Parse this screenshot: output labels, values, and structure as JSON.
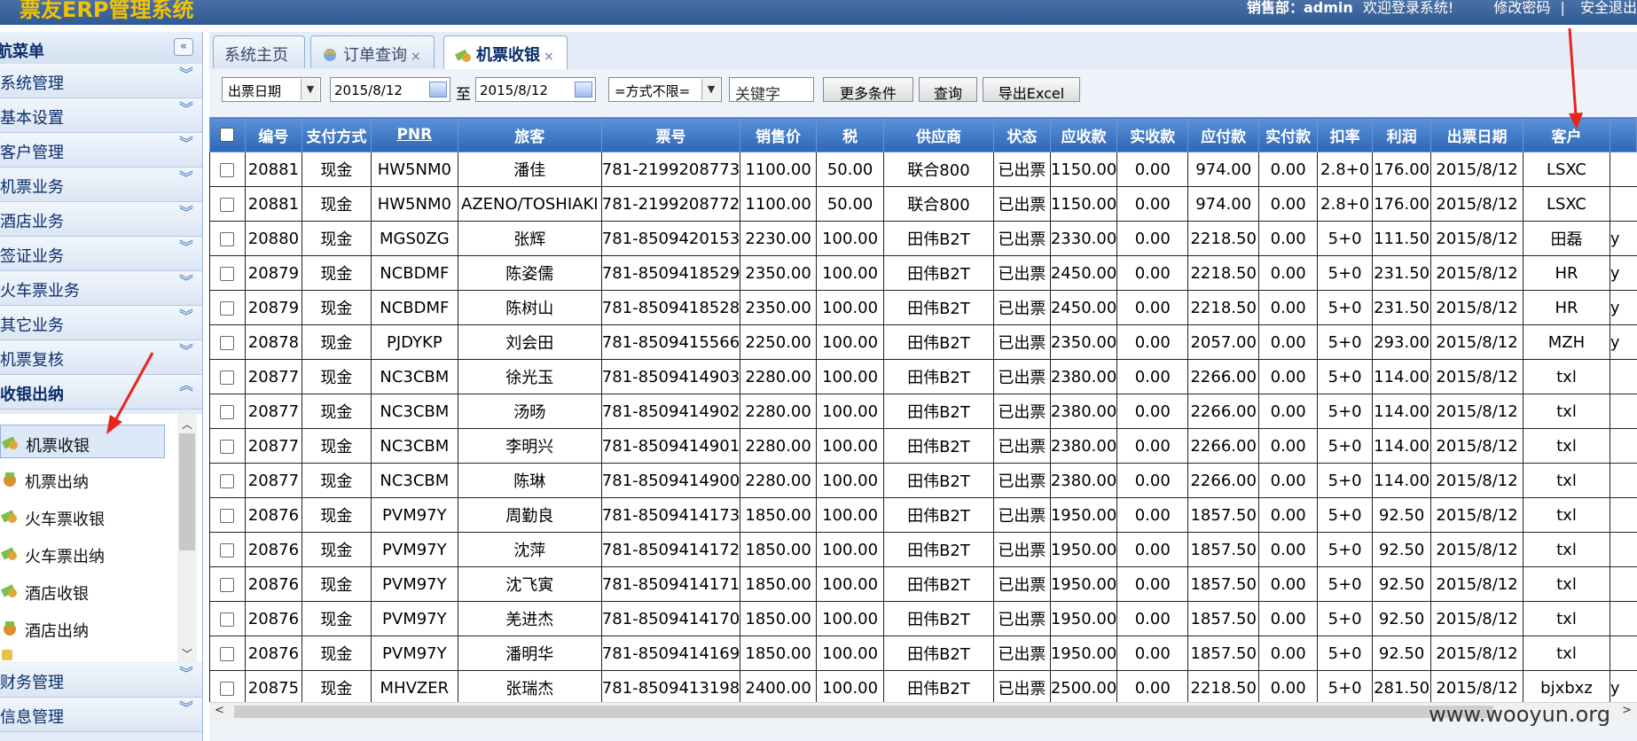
{
  "header": {
    "app_title": "票友ERP管理系统",
    "user_label": "销售部：admin",
    "welcome": "欢迎登录系统!",
    "change_password": "修改密码",
    "separator": "|",
    "logout": "安全退出"
  },
  "sidebar": {
    "title": "航菜单",
    "collapse_icon": "«",
    "groups": [
      {
        "label": "系统管理"
      },
      {
        "label": "基本设置"
      },
      {
        "label": "客户管理"
      },
      {
        "label": "机票业务"
      },
      {
        "label": "酒店业务"
      },
      {
        "label": "签证业务"
      },
      {
        "label": "火车票业务"
      },
      {
        "label": "其它业务"
      },
      {
        "label": "机票复核"
      },
      {
        "label": "收银出纳"
      }
    ],
    "sub_items": [
      {
        "label": "机票收银"
      },
      {
        "label": "机票出纳"
      },
      {
        "label": "火车票收银"
      },
      {
        "label": "火车票出纳"
      },
      {
        "label": "酒店收银"
      },
      {
        "label": "酒店出纳"
      }
    ],
    "bottom_groups": [
      {
        "label": "财务管理"
      },
      {
        "label": "信息管理"
      }
    ]
  },
  "tabs": [
    {
      "label": "系统主页",
      "closable": false
    },
    {
      "label": "订单查询",
      "closable": true
    },
    {
      "label": "机票收银",
      "closable": true,
      "active": true
    }
  ],
  "close_glyph": "×",
  "toolbar": {
    "date_type": "出票日期",
    "date_from": "2015/8/12",
    "to_label": "至",
    "date_to": "2015/8/12",
    "method": "=方式不限=",
    "keyword_placeholder": "关键字",
    "more_conditions": "更多条件",
    "query": "查询",
    "export_excel": "导出Excel"
  },
  "grid": {
    "columns": [
      "编号",
      "支付方式",
      "PNR",
      "旅客",
      "票号",
      "销售价",
      "税",
      "供应商",
      "状态",
      "应收款",
      "实收款",
      "应付款",
      "实付款",
      "扣率",
      "利润",
      "出票日期",
      "客户",
      ""
    ],
    "rows": [
      [
        "20881",
        "现金",
        "HW5NM0",
        "潘佳",
        "781-2199208773",
        "1100.00",
        "50.00",
        "联合800",
        "已出票",
        "1150.00",
        "0.00",
        "974.00",
        "0.00",
        "2.8+0",
        "176.00",
        "2015/8/12",
        "LSXC",
        ""
      ],
      [
        "20881",
        "现金",
        "HW5NM0",
        "AZENO/TOSHIAKI",
        "781-2199208772",
        "1100.00",
        "50.00",
        "联合800",
        "已出票",
        "1150.00",
        "0.00",
        "974.00",
        "0.00",
        "2.8+0",
        "176.00",
        "2015/8/12",
        "LSXC",
        ""
      ],
      [
        "20880",
        "现金",
        "MGS0ZG",
        "张辉",
        "781-8509420153",
        "2230.00",
        "100.00",
        "田伟B2T",
        "已出票",
        "2330.00",
        "0.00",
        "2218.50",
        "0.00",
        "5+0",
        "111.50",
        "2015/8/12",
        "田磊",
        "y"
      ],
      [
        "20879",
        "现金",
        "NCBDMF",
        "陈姿儒",
        "781-8509418529",
        "2350.00",
        "100.00",
        "田伟B2T",
        "已出票",
        "2450.00",
        "0.00",
        "2218.50",
        "0.00",
        "5+0",
        "231.50",
        "2015/8/12",
        "HR",
        "y"
      ],
      [
        "20879",
        "现金",
        "NCBDMF",
        "陈树山",
        "781-8509418528",
        "2350.00",
        "100.00",
        "田伟B2T",
        "已出票",
        "2450.00",
        "0.00",
        "2218.50",
        "0.00",
        "5+0",
        "231.50",
        "2015/8/12",
        "HR",
        "y"
      ],
      [
        "20878",
        "现金",
        "PJDYKP",
        "刘会田",
        "781-8509415566",
        "2250.00",
        "100.00",
        "田伟B2T",
        "已出票",
        "2350.00",
        "0.00",
        "2057.00",
        "0.00",
        "5+0",
        "293.00",
        "2015/8/12",
        "MZH",
        "y"
      ],
      [
        "20877",
        "现金",
        "NC3CBM",
        "徐光玉",
        "781-8509414903",
        "2280.00",
        "100.00",
        "田伟B2T",
        "已出票",
        "2380.00",
        "0.00",
        "2266.00",
        "0.00",
        "5+0",
        "114.00",
        "2015/8/12",
        "txl",
        ""
      ],
      [
        "20877",
        "现金",
        "NC3CBM",
        "汤旸",
        "781-8509414902",
        "2280.00",
        "100.00",
        "田伟B2T",
        "已出票",
        "2380.00",
        "0.00",
        "2266.00",
        "0.00",
        "5+0",
        "114.00",
        "2015/8/12",
        "txl",
        ""
      ],
      [
        "20877",
        "现金",
        "NC3CBM",
        "李明兴",
        "781-8509414901",
        "2280.00",
        "100.00",
        "田伟B2T",
        "已出票",
        "2380.00",
        "0.00",
        "2266.00",
        "0.00",
        "5+0",
        "114.00",
        "2015/8/12",
        "txl",
        ""
      ],
      [
        "20877",
        "现金",
        "NC3CBM",
        "陈琳",
        "781-8509414900",
        "2280.00",
        "100.00",
        "田伟B2T",
        "已出票",
        "2380.00",
        "0.00",
        "2266.00",
        "0.00",
        "5+0",
        "114.00",
        "2015/8/12",
        "txl",
        ""
      ],
      [
        "20876",
        "现金",
        "PVM97Y",
        "周勤良",
        "781-8509414173",
        "1850.00",
        "100.00",
        "田伟B2T",
        "已出票",
        "1950.00",
        "0.00",
        "1857.50",
        "0.00",
        "5+0",
        "92.50",
        "2015/8/12",
        "txl",
        ""
      ],
      [
        "20876",
        "现金",
        "PVM97Y",
        "沈萍",
        "781-8509414172",
        "1850.00",
        "100.00",
        "田伟B2T",
        "已出票",
        "1950.00",
        "0.00",
        "1857.50",
        "0.00",
        "5+0",
        "92.50",
        "2015/8/12",
        "txl",
        ""
      ],
      [
        "20876",
        "现金",
        "PVM97Y",
        "沈飞寅",
        "781-8509414171",
        "1850.00",
        "100.00",
        "田伟B2T",
        "已出票",
        "1950.00",
        "0.00",
        "1857.50",
        "0.00",
        "5+0",
        "92.50",
        "2015/8/12",
        "txl",
        ""
      ],
      [
        "20876",
        "现金",
        "PVM97Y",
        "羌进杰",
        "781-8509414170",
        "1850.00",
        "100.00",
        "田伟B2T",
        "已出票",
        "1950.00",
        "0.00",
        "1857.50",
        "0.00",
        "5+0",
        "92.50",
        "2015/8/12",
        "txl",
        ""
      ],
      [
        "20876",
        "现金",
        "PVM97Y",
        "潘明华",
        "781-8509414169",
        "1850.00",
        "100.00",
        "田伟B2T",
        "已出票",
        "1950.00",
        "0.00",
        "1857.50",
        "0.00",
        "5+0",
        "92.50",
        "2015/8/12",
        "txl",
        ""
      ],
      [
        "20875",
        "现金",
        "MHVZER",
        "张瑞杰",
        "781-8509413198",
        "2400.00",
        "100.00",
        "田伟B2T",
        "已出票",
        "2500.00",
        "0.00",
        "2218.50",
        "0.00",
        "5+0",
        "281.50",
        "2015/8/12",
        "bjxbxz",
        "y"
      ]
    ]
  },
  "watermark": "www.wooyun.org",
  "colors": {
    "header_bg": "#2f5a94",
    "title": "#f2c300",
    "grid_header": "#2d67b7",
    "annotation_arrow": "#e8241b"
  }
}
